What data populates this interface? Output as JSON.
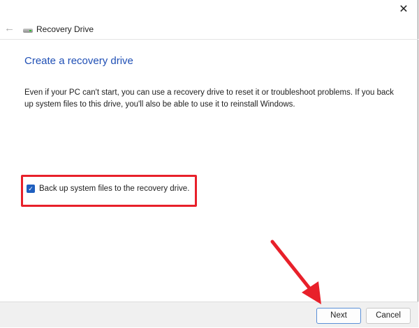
{
  "window": {
    "close_label": "✕"
  },
  "nav": {
    "back_icon": "←",
    "title": "Recovery Drive"
  },
  "main": {
    "heading": "Create a recovery drive",
    "description": "Even if your PC can't start, you can use a recovery drive to reset it or troubleshoot problems. If you back up system files to this drive, you'll also be able to use it to reinstall Windows.",
    "checkbox": {
      "label": "Back up system files to the recovery drive.",
      "checked": true,
      "mark": "✓"
    }
  },
  "footer": {
    "next_label": "Next",
    "cancel_label": "Cancel"
  },
  "annotation_color": "#e8202a"
}
